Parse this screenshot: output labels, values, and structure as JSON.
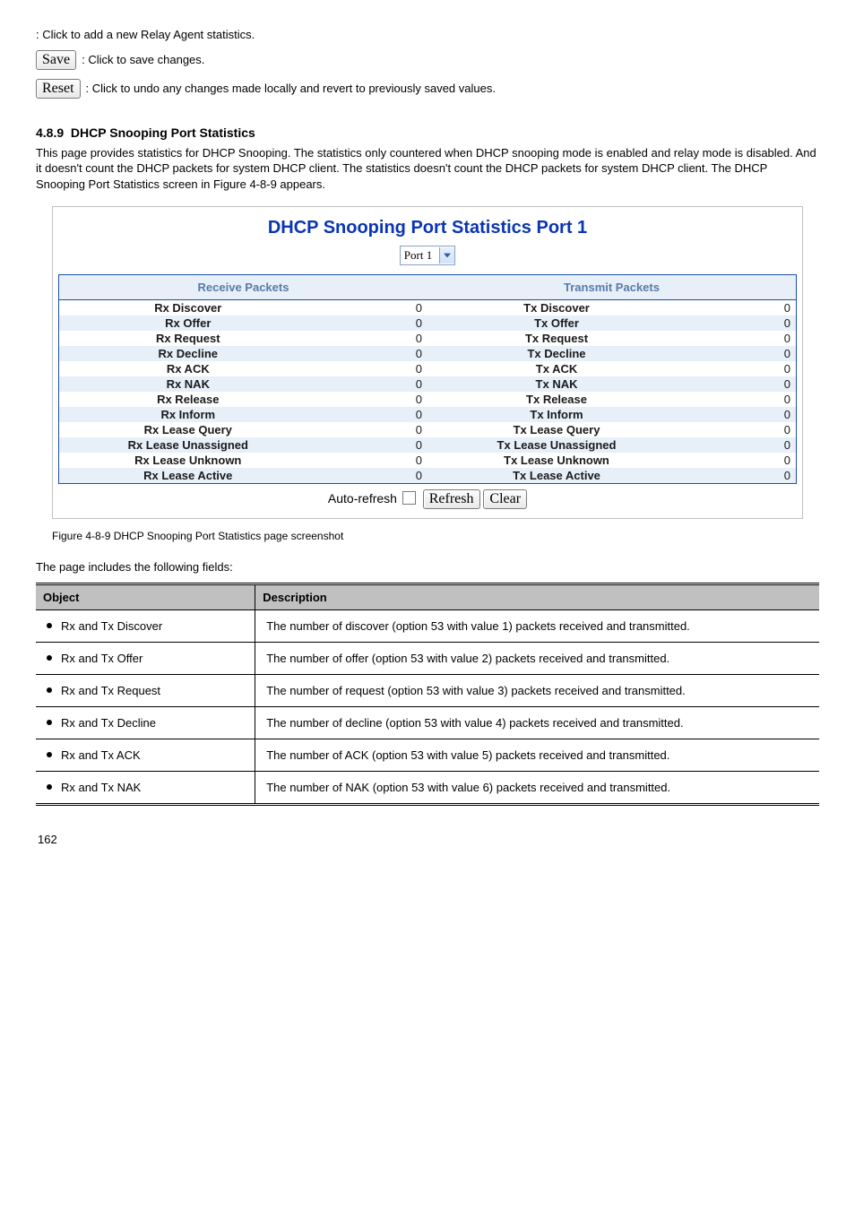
{
  "intro_text": ": Click to add a new Relay Agent statistics.",
  "save_button": {
    "label": "Save",
    "desc": ": Click to save changes."
  },
  "reset_button": {
    "label": "Reset",
    "desc": ": Click to undo any changes made locally and revert to previously saved values."
  },
  "section": {
    "number": "4.8.9",
    "title": "DHCP Snooping Port Statistics",
    "body": "This page provides statistics for DHCP Snooping. The statistics only countered when DHCP snooping mode is enabled and relay mode is disabled. And it doesn't count the DHCP packets for system DHCP client. The statistics doesn't count the DHCP packets for system DHCP client. The DHCP Snooping Port Statistics screen in Figure 4-8-9 appears."
  },
  "screenshot": {
    "title": "DHCP Snooping Port Statistics  Port 1",
    "port_selected": "Port 1",
    "header_rx": "Receive Packets",
    "header_tx": "Transmit Packets",
    "rows": [
      {
        "rx_label": "Rx Discover",
        "rx_val": "0",
        "tx_label": "Tx Discover",
        "tx_val": "0"
      },
      {
        "rx_label": "Rx Offer",
        "rx_val": "0",
        "tx_label": "Tx Offer",
        "tx_val": "0"
      },
      {
        "rx_label": "Rx Request",
        "rx_val": "0",
        "tx_label": "Tx Request",
        "tx_val": "0"
      },
      {
        "rx_label": "Rx Decline",
        "rx_val": "0",
        "tx_label": "Tx Decline",
        "tx_val": "0"
      },
      {
        "rx_label": "Rx ACK",
        "rx_val": "0",
        "tx_label": "Tx ACK",
        "tx_val": "0"
      },
      {
        "rx_label": "Rx NAK",
        "rx_val": "0",
        "tx_label": "Tx NAK",
        "tx_val": "0"
      },
      {
        "rx_label": "Rx Release",
        "rx_val": "0",
        "tx_label": "Tx Release",
        "tx_val": "0"
      },
      {
        "rx_label": "Rx Inform",
        "rx_val": "0",
        "tx_label": "Tx Inform",
        "tx_val": "0"
      },
      {
        "rx_label": "Rx Lease Query",
        "rx_val": "0",
        "tx_label": "Tx Lease Query",
        "tx_val": "0"
      },
      {
        "rx_label": "Rx Lease Unassigned",
        "rx_val": "0",
        "tx_label": "Tx Lease Unassigned",
        "tx_val": "0"
      },
      {
        "rx_label": "Rx Lease Unknown",
        "rx_val": "0",
        "tx_label": "Tx Lease Unknown",
        "tx_val": "0"
      },
      {
        "rx_label": "Rx Lease Active",
        "rx_val": "0",
        "tx_label": "Tx Lease Active",
        "tx_val": "0"
      }
    ],
    "auto_refresh_label": "Auto-refresh",
    "refresh_label": "Refresh",
    "clear_label": "Clear"
  },
  "figure_caption": "Figure 4-8-9 DHCP Snooping Port Statistics page screenshot",
  "desc_intro": "The page includes the following fields:",
  "desc_table": {
    "head_obj": "Object",
    "head_desc": "Description",
    "rows": [
      {
        "obj": "Rx and Tx Discover",
        "desc": "The number of discover (option 53 with value 1) packets received and transmitted."
      },
      {
        "obj": "Rx and Tx Offer",
        "desc": "The number of offer (option 53 with value 2) packets received and transmitted."
      },
      {
        "obj": "Rx and Tx Request",
        "desc": "The number of request (option 53 with value 3) packets received and transmitted."
      },
      {
        "obj": "Rx and Tx Decline",
        "desc": "The number of decline (option 53 with value 4) packets received and transmitted."
      },
      {
        "obj": "Rx and Tx ACK",
        "desc": "The number of ACK (option 53 with value 5) packets received and transmitted."
      },
      {
        "obj": "Rx and Tx NAK",
        "desc": "The number of NAK (option 53 with value 6) packets received and transmitted."
      }
    ]
  },
  "page_number": "162"
}
